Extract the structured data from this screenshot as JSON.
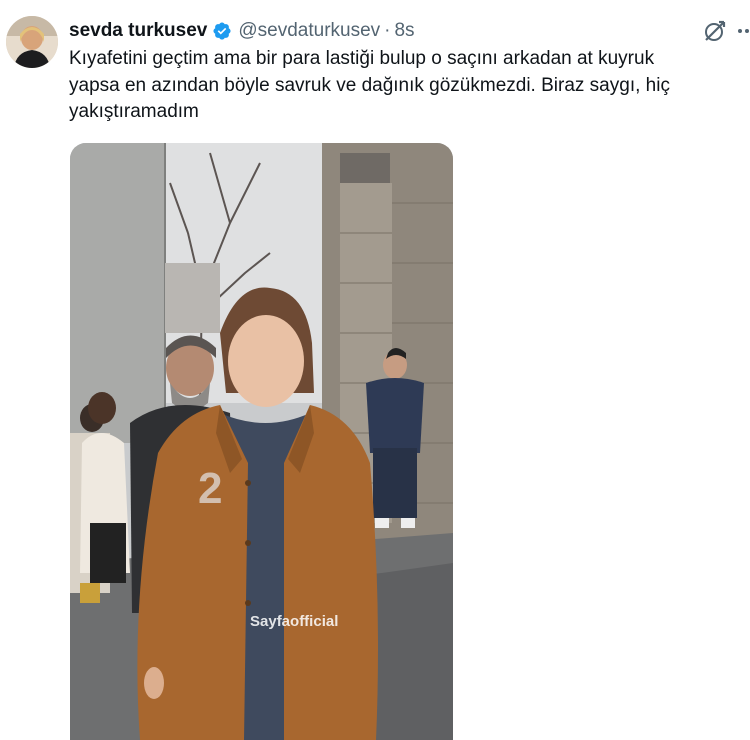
{
  "author": {
    "display_name": "sevda turkusev",
    "handle": "@sevdaturkusev",
    "separator": "·",
    "time": "8s",
    "verified_icon": "verified-badge-icon",
    "verified_color": "#1d9bf0"
  },
  "tweet": {
    "text_line_1": "Kıyafetini geçtim ama bir para lastiği bulup o saçını arkadan at kuyruk",
    "text_line_2": "yapsa en azından böyle savruk ve dağınık gözükmezdi. Biraz saygı, hiç",
    "text_line_3": "yakıştıramadım"
  },
  "media": {
    "watermark_text": "Sayfaofficial"
  },
  "actions": {
    "grok_icon": "grok-icon",
    "more_icon": "more-icon"
  },
  "colors": {
    "text": "#0f1419",
    "secondary": "#536471",
    "jacket": "#a8672f"
  }
}
